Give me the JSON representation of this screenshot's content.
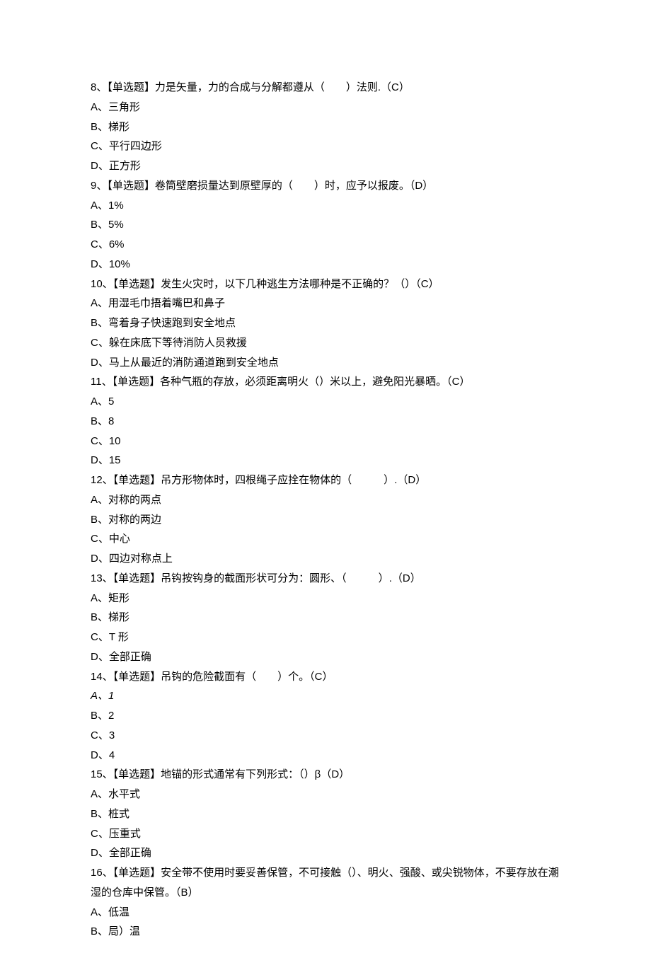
{
  "lines": [
    {
      "text": "8、【单选题】力是矢量，力的合成与分解都遵从（　　）法则.（C）",
      "italic": false
    },
    {
      "text": "A、三角形",
      "italic": false
    },
    {
      "text": "B、梯形",
      "italic": false
    },
    {
      "text": "C、平行四边形",
      "italic": false
    },
    {
      "text": "D、正方形",
      "italic": false
    },
    {
      "text": "9、【单选题】卷筒壁磨损量达到原壁厚的（　　）时，应予以报废。（D）",
      "italic": false
    },
    {
      "text": "A、1%",
      "italic": false
    },
    {
      "text": "B、5%",
      "italic": false
    },
    {
      "text": "C、6%",
      "italic": false
    },
    {
      "text": "D、10%",
      "italic": false
    },
    {
      "text": "10、【单选题】发生火灾时，以下几种逃生方法哪种是不正确的？（）（C）",
      "italic": false
    },
    {
      "text": "A、用湿毛巾捂着嘴巴和鼻子",
      "italic": false
    },
    {
      "text": "B、弯着身子快速跑到安全地点",
      "italic": false
    },
    {
      "text": "C、躲在床底下等待消防人员救援",
      "italic": false
    },
    {
      "text": "D、马上从最近的消防通道跑到安全地点",
      "italic": false
    },
    {
      "text": "11、【单选题】各种气瓶的存放，必须距离明火（）米以上，避免阳光暴晒。（C）",
      "italic": false
    },
    {
      "text": "A、5",
      "italic": false
    },
    {
      "text": "B、8",
      "italic": false
    },
    {
      "text": "C、10",
      "italic": false
    },
    {
      "text": "D、15",
      "italic": false
    },
    {
      "text": "12、【单选题】吊方形物体时，四根绳子应拴在物体的（　　　）.（D）",
      "italic": false
    },
    {
      "text": "A、对称的两点",
      "italic": false
    },
    {
      "text": "B、对称的两边",
      "italic": false
    },
    {
      "text": "C、中心",
      "italic": false
    },
    {
      "text": "D、四边对称点上",
      "italic": false
    },
    {
      "text": "13、【单选题】吊钩按钩身的截面形状可分为：圆形、（　　　）.（D）",
      "italic": false
    },
    {
      "text": "A、矩形",
      "italic": false
    },
    {
      "text": "B、梯形",
      "italic": false
    },
    {
      "text": "C、T 形",
      "italic": false
    },
    {
      "text": "D、全部正确",
      "italic": false
    },
    {
      "text": "14、【单选题】吊钩的危险截面有（　　）个。（C）",
      "italic": false
    },
    {
      "text": "A、1",
      "italic": true
    },
    {
      "text": "B、2",
      "italic": false
    },
    {
      "text": "C、3",
      "italic": false
    },
    {
      "text": "D、4",
      "italic": false
    },
    {
      "text": "15、【单选题】地锚的形式通常有下列形式：（）β（D）",
      "italic": false
    },
    {
      "text": "A、水平式",
      "italic": false
    },
    {
      "text": "B、桩式",
      "italic": false
    },
    {
      "text": "C、压重式",
      "italic": false
    },
    {
      "text": "D、全部正确",
      "italic": false
    },
    {
      "text": "16、【单选题】安全带不使用时要妥善保管，不可接触（）、明火、强酸、或尖锐物体，不要存放在潮湿的仓库中保管。（B）",
      "italic": false
    },
    {
      "text": "A、低温",
      "italic": false
    },
    {
      "text": "B、局）温",
      "italic": false
    }
  ]
}
